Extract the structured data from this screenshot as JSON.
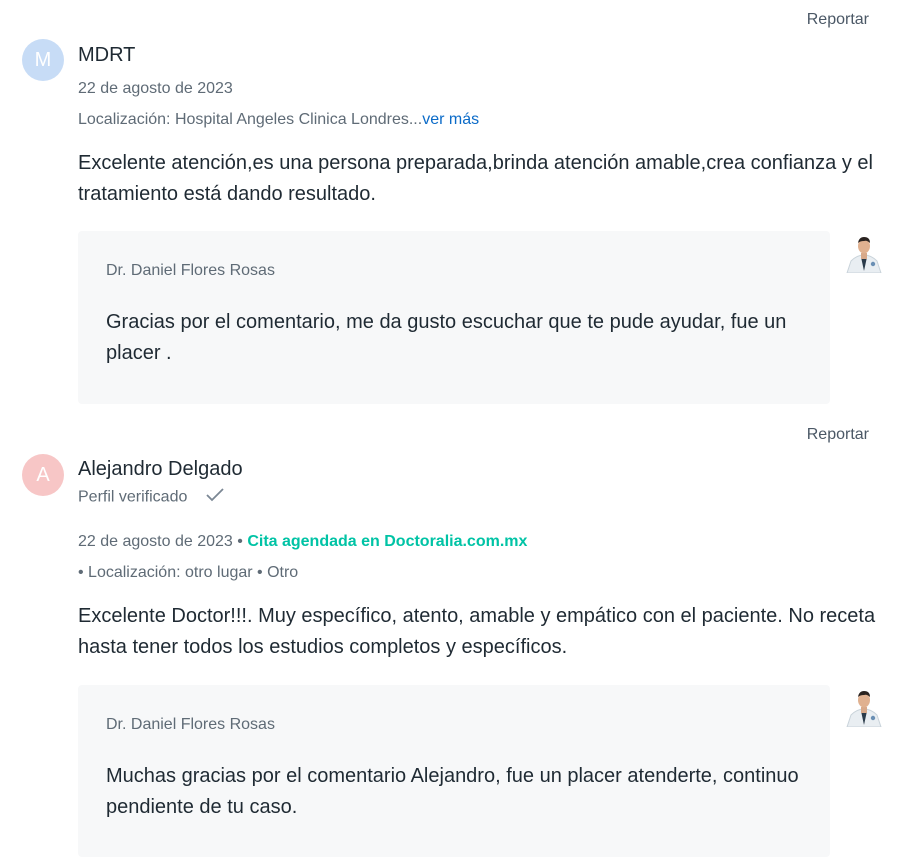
{
  "reviews": [
    {
      "report_label": "Reportar",
      "avatar_letter": "M",
      "name": "MDRT",
      "date": "22 de agosto de 2023",
      "location_prefix": "Localización: Hospital Angeles Clinica Londres...",
      "see_more": "ver más",
      "text": "Excelente atención,es una persona preparada,brinda atención amable,crea confianza y el tratamiento está dando resultado.",
      "reply": {
        "doctor": "Dr. Daniel Flores Rosas",
        "text": "Gracias por el comentario, me da gusto escuchar que te pude ayudar, fue un placer ."
      }
    },
    {
      "report_label": "Reportar",
      "avatar_letter": "A",
      "name": "Alejandro Delgado",
      "verified": "Perfil verificado",
      "date": "22 de agosto de 2023",
      "date_sep": " • ",
      "booking": "Cita agendada en Doctoralia.com.mx",
      "location": "• Localización: otro lugar • Otro",
      "text": "Excelente Doctor!!!. Muy específico, atento, amable y empático con el paciente. No receta hasta tener todos los estudios completos y específicos.",
      "reply": {
        "doctor": "Dr. Daniel Flores Rosas",
        "text": "Muchas gracias por el comentario Alejandro, fue un placer atenderte, continuo pendiente de tu caso."
      }
    }
  ],
  "colors": {
    "accent_link": "#0b6bc8",
    "booking_green": "#00c3a5",
    "avatar_m": "#c7dcf6",
    "avatar_a": "#f7c6c6"
  }
}
